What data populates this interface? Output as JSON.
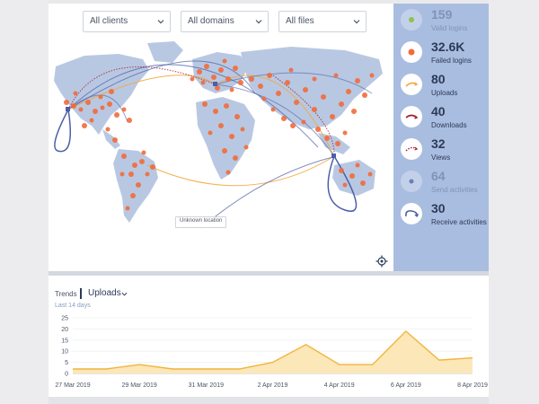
{
  "filters": [
    {
      "label": "All clients"
    },
    {
      "label": "All domains"
    },
    {
      "label": "All files"
    }
  ],
  "map": {
    "unknown_location_label": "Unknown location",
    "accent_color": "#f26b3a",
    "route_colors": [
      "#4b5fa8",
      "#f3a73b",
      "#a11d2f"
    ]
  },
  "stats": [
    {
      "value": "159",
      "label": "Valid logins",
      "icon": "valid-login-icon",
      "dim": true
    },
    {
      "value": "32.6K",
      "label": "Failed logins",
      "icon": "failed-login-icon",
      "dim": false
    },
    {
      "value": "80",
      "label": "Uploads",
      "icon": "upload-icon",
      "dim": false
    },
    {
      "value": "40",
      "label": "Downloads",
      "icon": "download-icon",
      "dim": false
    },
    {
      "value": "32",
      "label": "Views",
      "icon": "view-icon",
      "dim": false
    },
    {
      "value": "64",
      "label": "Send activities",
      "icon": "send-icon",
      "dim": true
    },
    {
      "value": "30",
      "label": "Receive activities",
      "icon": "receive-icon",
      "dim": false
    }
  ],
  "trends": {
    "title": "Trends",
    "metric": "Uploads",
    "range_label": "Last 14 days"
  },
  "chart_data": {
    "type": "area",
    "x": [
      "27 Mar 2019",
      "28 Mar 2019",
      "29 Mar 2019",
      "30 Mar 2019",
      "31 Mar 2019",
      "1 Apr 2019",
      "2 Apr 2019",
      "3 Apr 2019",
      "4 Apr 2019",
      "5 Apr 2019",
      "6 Apr 2019",
      "7 Apr 2019",
      "8 Apr 2019"
    ],
    "tick_labels": [
      "27 Mar 2019",
      "29 Mar 2019",
      "31 Mar 2019",
      "2 Apr 2019",
      "4 Apr 2019",
      "6 Apr 2019",
      "8 Apr 2019"
    ],
    "series": [
      {
        "values": [
          2,
          2,
          4,
          2,
          2,
          2,
          5,
          13,
          4,
          4,
          19,
          6,
          7
        ]
      }
    ],
    "yticks": [
      0,
      5,
      10,
      15,
      20,
      25
    ],
    "ylim": [
      0,
      25
    ],
    "line_color": "#f2b43a",
    "fill_color": "#fbe7b8"
  }
}
